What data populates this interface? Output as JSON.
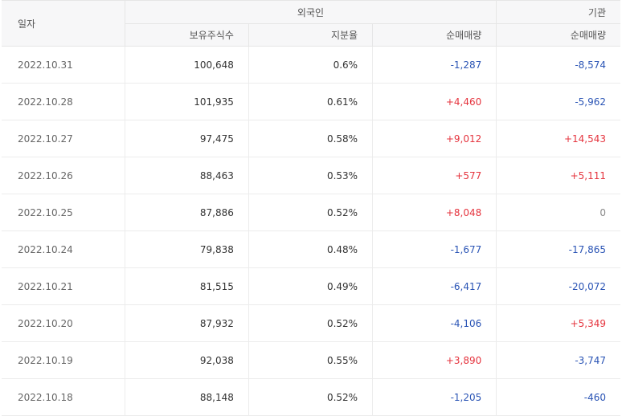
{
  "headers": {
    "date": "일자",
    "foreign": "외국인",
    "institution": "기관",
    "holdings": "보유주식수",
    "share_ratio": "지분율",
    "foreign_net": "순매매량",
    "inst_net": "순매매량"
  },
  "colors": {
    "up": "#e5343e",
    "down": "#2a54b5"
  },
  "rows": [
    {
      "date": "2022.10.31",
      "holdings": "100,648",
      "ratio": "0.6%",
      "foreign_net": "-1,287",
      "inst_net": "-8,574"
    },
    {
      "date": "2022.10.28",
      "holdings": "101,935",
      "ratio": "0.61%",
      "foreign_net": "+4,460",
      "inst_net": "-5,962"
    },
    {
      "date": "2022.10.27",
      "holdings": "97,475",
      "ratio": "0.58%",
      "foreign_net": "+9,012",
      "inst_net": "+14,543"
    },
    {
      "date": "2022.10.26",
      "holdings": "88,463",
      "ratio": "0.53%",
      "foreign_net": "+577",
      "inst_net": "+5,111"
    },
    {
      "date": "2022.10.25",
      "holdings": "87,886",
      "ratio": "0.52%",
      "foreign_net": "+8,048",
      "inst_net": "0"
    },
    {
      "date": "2022.10.24",
      "holdings": "79,838",
      "ratio": "0.48%",
      "foreign_net": "-1,677",
      "inst_net": "-17,865"
    },
    {
      "date": "2022.10.21",
      "holdings": "81,515",
      "ratio": "0.49%",
      "foreign_net": "-6,417",
      "inst_net": "-20,072"
    },
    {
      "date": "2022.10.20",
      "holdings": "87,932",
      "ratio": "0.52%",
      "foreign_net": "-4,106",
      "inst_net": "+5,349"
    },
    {
      "date": "2022.10.19",
      "holdings": "92,038",
      "ratio": "0.55%",
      "foreign_net": "+3,890",
      "inst_net": "-3,747"
    },
    {
      "date": "2022.10.18",
      "holdings": "88,148",
      "ratio": "0.52%",
      "foreign_net": "-1,205",
      "inst_net": "-460"
    }
  ]
}
